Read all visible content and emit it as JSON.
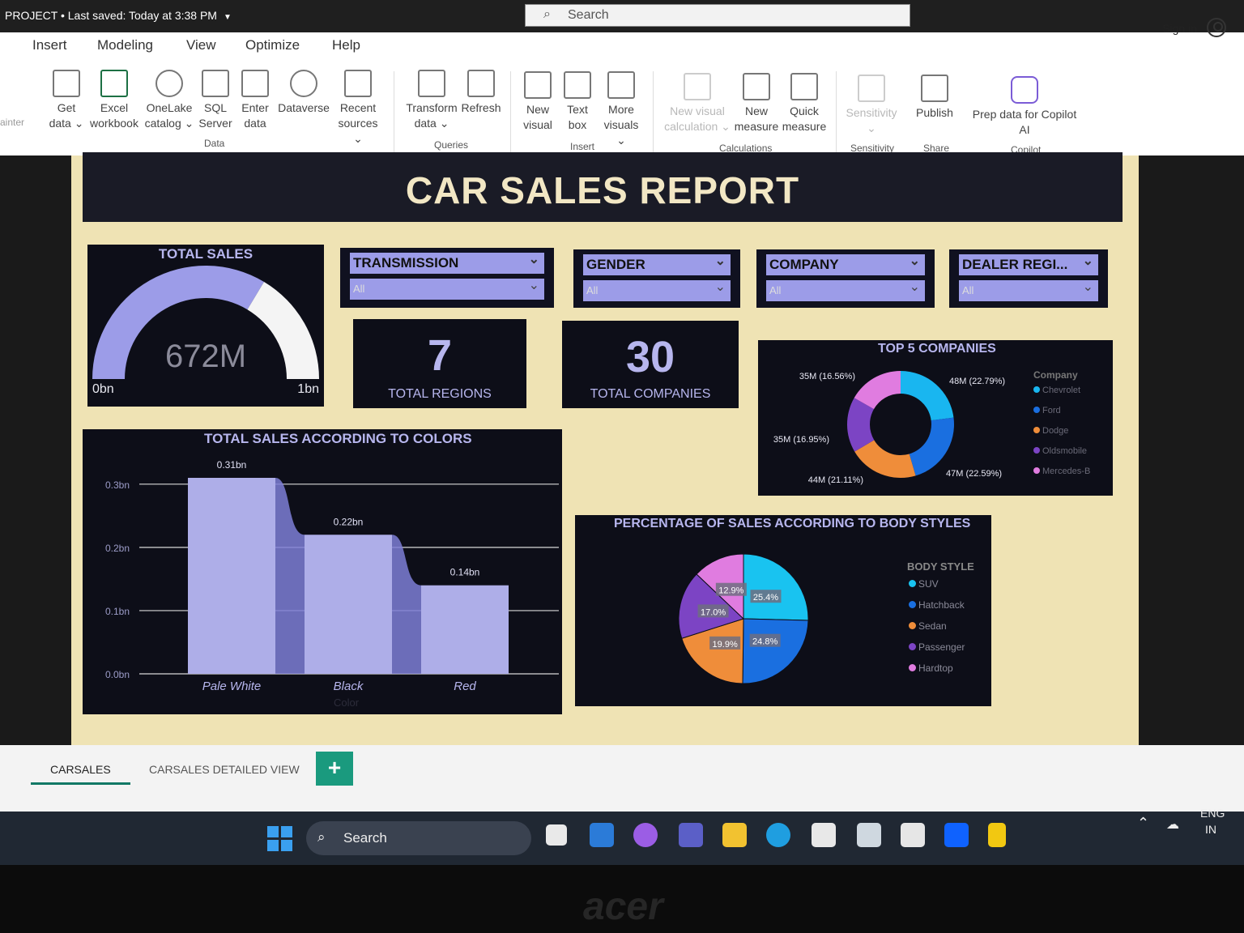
{
  "titlebar": {
    "project": "PROJECT • Last saved: Today at 3:38 PM",
    "search_placeholder": "Search",
    "signin": "Sign in"
  },
  "menu": [
    "Insert",
    "Modeling",
    "View",
    "Optimize",
    "Help"
  ],
  "ribbon": {
    "left_cut": "ainter",
    "tools": {
      "get_data": [
        "Get",
        "data ⌄"
      ],
      "excel": [
        "Excel",
        "workbook"
      ],
      "onelake": [
        "OneLake",
        "catalog ⌄"
      ],
      "sql": [
        "SQL",
        "Server"
      ],
      "enter": [
        "Enter",
        "data"
      ],
      "dataverse": [
        "Dataverse",
        ""
      ],
      "recent": [
        "Recent",
        "sources ⌄"
      ],
      "transform": [
        "Transform",
        "data ⌄"
      ],
      "refresh": [
        "Refresh",
        ""
      ],
      "newvisual": [
        "New",
        "visual"
      ],
      "textbox": [
        "Text",
        "box"
      ],
      "more": [
        "More",
        "visuals ⌄"
      ],
      "newcalc": [
        "New visual",
        "calculation ⌄"
      ],
      "newmeasure": [
        "New",
        "measure"
      ],
      "quick": [
        "Quick",
        "measure"
      ],
      "sensitivity": [
        "Sensitivity",
        "⌄"
      ],
      "publish": [
        "Publish",
        ""
      ],
      "copilot": [
        "Prep data for Copilot",
        "AI"
      ]
    },
    "groups": {
      "data": "Data",
      "queries": "Queries",
      "insert": "Insert",
      "calculations": "Calculations",
      "sensitivity": "Sensitivity",
      "share": "Share",
      "copilot": "Copilot"
    }
  },
  "report": {
    "title": "CAR SALES REPORT",
    "total_sales": {
      "title": "TOTAL SALES",
      "value": "672M",
      "min": "0bn",
      "max": "1bn",
      "fraction": 0.672
    },
    "slicers": [
      {
        "label": "TRANSMISSION",
        "value": "All"
      },
      {
        "label": "GENDER",
        "value": "All"
      },
      {
        "label": "COMPANY",
        "value": "All"
      },
      {
        "label": "DEALER REGI...",
        "value": "All"
      }
    ],
    "kpi_regions": {
      "value": "7",
      "label": "TOTAL REGIONS"
    },
    "kpi_companies": {
      "value": "30",
      "label": "TOTAL COMPANIES"
    },
    "bar_chart_title": "TOTAL SALES ACCORDING TO COLORS",
    "bar_axis_label": "Color",
    "donut_title": "TOP 5 COMPANIES",
    "donut_legend_title": "Company",
    "pie_title": "PERCENTAGE OF SALES ACCORDING TO BODY STYLES",
    "pie_legend_title": "BODY STYLE"
  },
  "chart_data": [
    {
      "type": "bar",
      "title": "TOTAL SALES ACCORDING TO COLORS",
      "categories": [
        "Pale White",
        "Black",
        "Red"
      ],
      "values": [
        0.31,
        0.22,
        0.14
      ],
      "data_labels": [
        "0.31bn",
        "0.22bn",
        "0.14bn"
      ],
      "y_ticks": [
        "0.0bn",
        "0.1bn",
        "0.2bn",
        "0.3bn"
      ],
      "ylim": [
        0,
        0.31
      ],
      "xlabel": "Color",
      "ylabel": "",
      "grid": true,
      "color": "#aeaee8"
    },
    {
      "type": "pie",
      "title": "TOP 5 COMPANIES",
      "donut": true,
      "legend_title": "Company",
      "categories": [
        "Chevrolet",
        "Ford",
        "Dodge",
        "Oldsmobile",
        "Mercedes-B"
      ],
      "values": [
        48,
        47,
        44,
        35,
        35
      ],
      "labels": [
        "48M (22.79%)",
        "47M (22.59%)",
        "44M (21.11%)",
        "35M (16.95%)",
        "35M (16.56%)"
      ],
      "colors": [
        "#19b6f0",
        "#1a6fe0",
        "#ef8d3a",
        "#7c44c4",
        "#e07ce0"
      ]
    },
    {
      "type": "pie",
      "title": "PERCENTAGE OF SALES ACCORDING TO BODY STYLES",
      "legend_title": "BODY STYLE",
      "categories": [
        "SUV",
        "Hatchback",
        "Sedan",
        "Passenger",
        "Hardtop"
      ],
      "values": [
        25.4,
        24.8,
        19.9,
        17.0,
        12.9
      ],
      "labels": [
        "25.4%",
        "24.8%",
        "19.9%",
        "17.0%",
        "12.9%"
      ],
      "colors": [
        "#19c3f0",
        "#1a6fe0",
        "#ef8d3a",
        "#7c44c4",
        "#e07ce0"
      ]
    }
  ],
  "tabs": [
    "CARSALES",
    "CARSALES DETAILED VIEW"
  ],
  "add_tab": "+",
  "taskbar": {
    "search": "Search",
    "lang": "ENG",
    "region": "IN"
  },
  "brand": "acer"
}
